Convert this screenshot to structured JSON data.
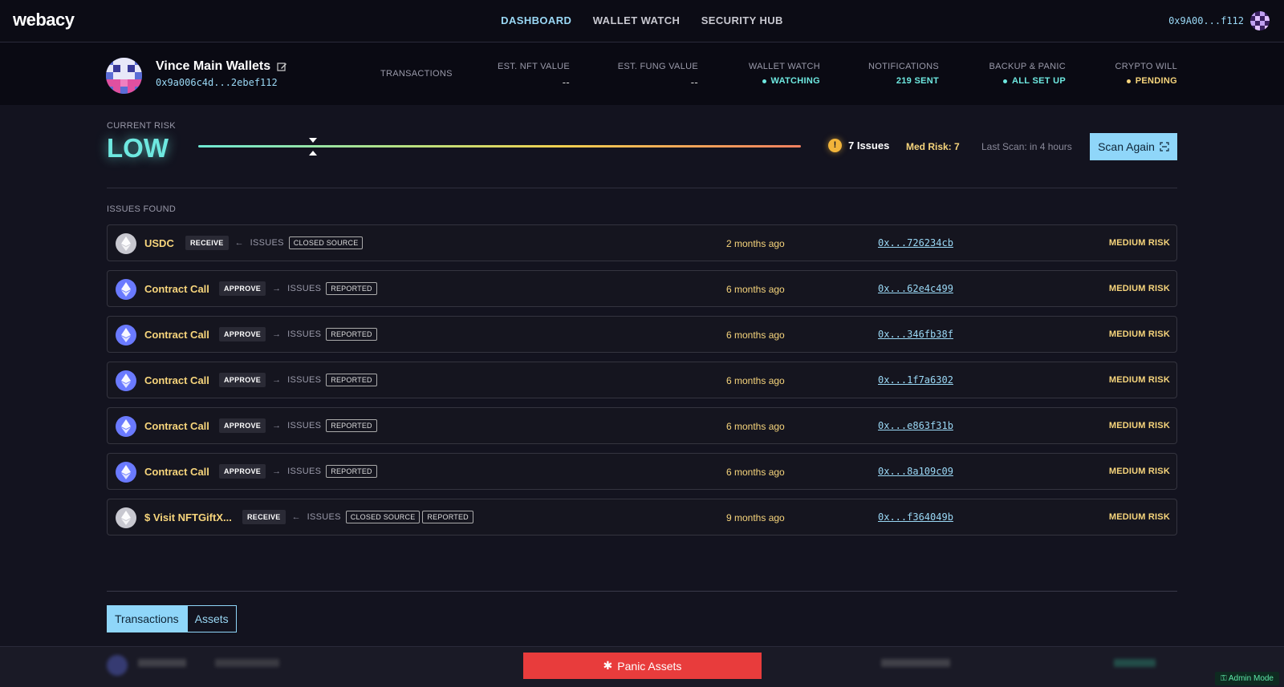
{
  "app": {
    "logo": "webacy"
  },
  "nav": {
    "items": [
      {
        "label": "DASHBOARD",
        "active": true
      },
      {
        "label": "WALLET WATCH",
        "active": false
      },
      {
        "label": "SECURITY HUB",
        "active": false
      }
    ]
  },
  "account": {
    "address": "0x9A00...f112"
  },
  "wallet": {
    "name": "Vince Main Wallets",
    "address": "0x9a006c4d...2ebef112"
  },
  "stats": {
    "transactions": {
      "label": "TRANSACTIONS",
      "value": ""
    },
    "nft": {
      "label": "EST. NFT VALUE",
      "value": "--"
    },
    "fung": {
      "label": "EST. FUNG VALUE",
      "value": "--"
    },
    "watch": {
      "label": "WALLET WATCH",
      "value": "WATCHING",
      "color": "#6ee8e0"
    },
    "notifications": {
      "label": "NOTIFICATIONS",
      "value": "219 SENT",
      "color": "#6ee8e0"
    },
    "backup": {
      "label": "BACKUP & PANIC",
      "value": "ALL SET UP",
      "color": "#6ee8e0"
    },
    "will": {
      "label": "CRYPTO WILL",
      "value": "PENDING",
      "color": "#f7d57c"
    }
  },
  "risk": {
    "label": "CURRENT RISK",
    "value": "LOW",
    "level": 0.19,
    "issues": "7 Issues",
    "medrisk": "Med Risk: 7",
    "last_scan": "Last Scan: in 4 hours",
    "scan_button": "Scan Again"
  },
  "issues_found_label": "ISSUES FOUND",
  "issues_label": "ISSUES",
  "rows": [
    {
      "name": "USDC",
      "action": "RECEIVE",
      "direction": "in",
      "tags": [
        "CLOSED SOURCE"
      ],
      "time": "2 months ago",
      "hash": "0x...726234cb",
      "risk": "MEDIUM RISK",
      "token": "eth-grey"
    },
    {
      "name": "Contract Call",
      "action": "APPROVE",
      "direction": "out",
      "tags": [
        "REPORTED"
      ],
      "time": "6 months ago",
      "hash": "0x...62e4c499",
      "risk": "MEDIUM RISK",
      "token": "eth-blue"
    },
    {
      "name": "Contract Call",
      "action": "APPROVE",
      "direction": "out",
      "tags": [
        "REPORTED"
      ],
      "time": "6 months ago",
      "hash": "0x...346fb38f",
      "risk": "MEDIUM RISK",
      "token": "eth-blue"
    },
    {
      "name": "Contract Call",
      "action": "APPROVE",
      "direction": "out",
      "tags": [
        "REPORTED"
      ],
      "time": "6 months ago",
      "hash": "0x...1f7a6302",
      "risk": "MEDIUM RISK",
      "token": "eth-blue"
    },
    {
      "name": "Contract Call",
      "action": "APPROVE",
      "direction": "out",
      "tags": [
        "REPORTED"
      ],
      "time": "6 months ago",
      "hash": "0x...e863f31b",
      "risk": "MEDIUM RISK",
      "token": "eth-blue"
    },
    {
      "name": "Contract Call",
      "action": "APPROVE",
      "direction": "out",
      "tags": [
        "REPORTED"
      ],
      "time": "6 months ago",
      "hash": "0x...8a109c09",
      "risk": "MEDIUM RISK",
      "token": "eth-blue"
    },
    {
      "name": "$ Visit NFTGiftX...",
      "action": "RECEIVE",
      "direction": "in",
      "tags": [
        "CLOSED SOURCE",
        "REPORTED"
      ],
      "time": "9 months ago",
      "hash": "0x...f364049b",
      "risk": "MEDIUM RISK",
      "token": "eth-grey"
    }
  ],
  "tabs": [
    {
      "label": "Transactions",
      "active": true
    },
    {
      "label": "Assets",
      "active": false
    }
  ],
  "footer": {
    "panic_button": "Panic Assets",
    "admin": "Admin Mode"
  },
  "colors": {
    "accent": "#8fd6f9",
    "yellow": "#f7d57c",
    "danger": "#e83c3c",
    "low": "#6ee8e0"
  }
}
